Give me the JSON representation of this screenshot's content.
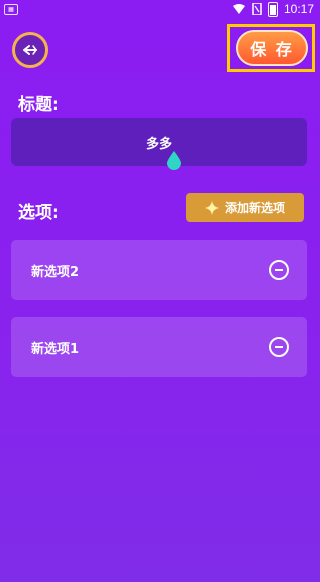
{
  "status_bar": {
    "time": "10:17"
  },
  "header": {
    "save_label": "保 存"
  },
  "title_section": {
    "label": "标题:",
    "value": "多多"
  },
  "options_section": {
    "label": "选项:",
    "add_label": "添加新选项",
    "items": [
      {
        "label": "新选项2"
      },
      {
        "label": "新选项1"
      }
    ]
  },
  "colors": {
    "background": "#8b1cf2",
    "accent": "#ff6a34",
    "highlight": "#ffcc00",
    "add_button": "#d99a38"
  }
}
